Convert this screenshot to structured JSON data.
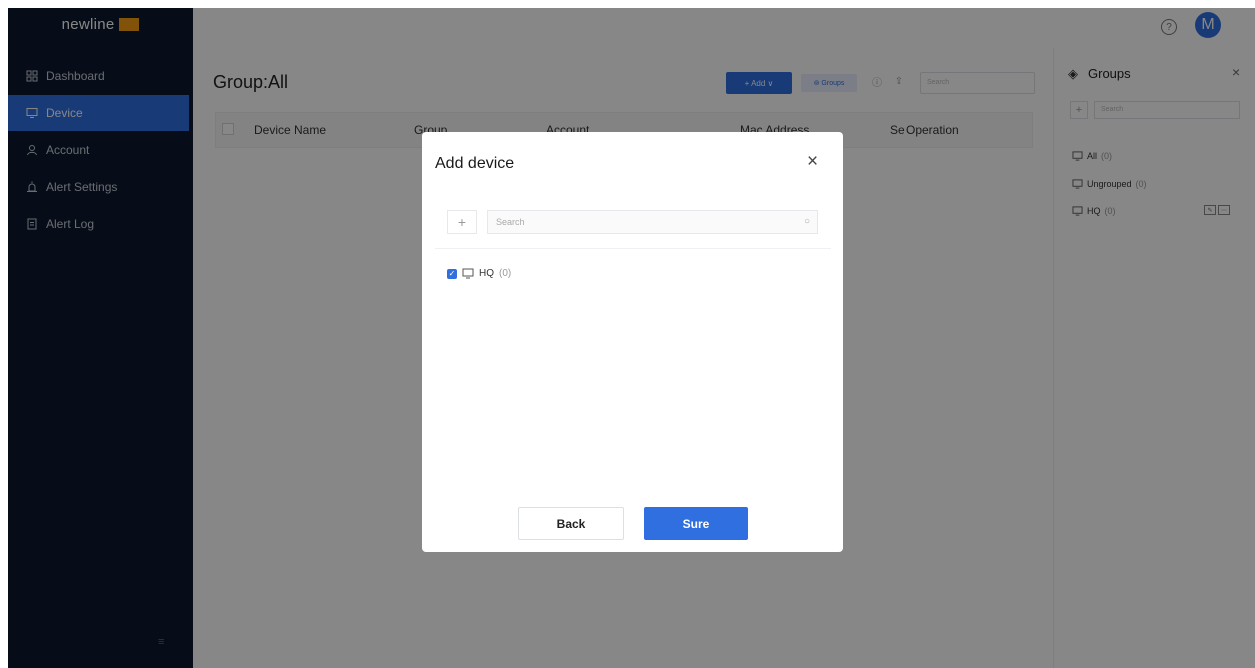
{
  "app": {
    "logo_text": "newline",
    "logo_badge": ""
  },
  "sidebar": {
    "items": [
      {
        "label": "Dashboard",
        "icon": "dashboard-icon"
      },
      {
        "label": "Device",
        "icon": "monitor-icon"
      },
      {
        "label": "Account",
        "icon": "user-icon"
      },
      {
        "label": "Alert Settings",
        "icon": "alarm-icon"
      },
      {
        "label": "Alert Log",
        "icon": "document-icon"
      }
    ],
    "active": "Device"
  },
  "header": {
    "help_glyph": "?",
    "avatar_letter": "M"
  },
  "main": {
    "title": "Group:All",
    "toolbar": {
      "add_label": "+ Add ∨",
      "groups_label": "⊚ Groups",
      "search_placeholder": "Search"
    },
    "columns": [
      "Device Name",
      "Group",
      "Account",
      "Mac Address",
      "Se",
      "Operation"
    ]
  },
  "groups_panel": {
    "title": "Groups",
    "search_placeholder": "Search",
    "items": [
      {
        "label": "All",
        "count": "(0)"
      },
      {
        "label": "Ungrouped",
        "count": "(0)"
      },
      {
        "label": "HQ",
        "count": "(0)"
      }
    ]
  },
  "modal": {
    "title": "Add device",
    "search_placeholder": "Search",
    "item": {
      "label": "HQ",
      "count": "(0)",
      "checked": true
    },
    "back_label": "Back",
    "sure_label": "Sure"
  },
  "colors": {
    "primary": "#2f6fe0",
    "sidebar_bg": "#0f1a2e",
    "logo_badge": "#f39c12"
  }
}
